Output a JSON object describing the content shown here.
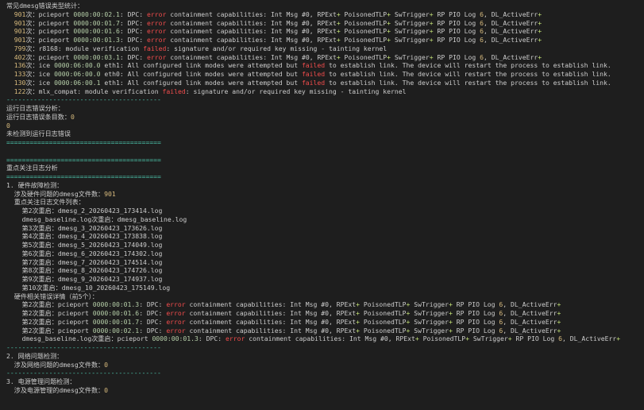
{
  "lines": [
    [
      {
        "t": "常见dmesg错误类型统计："
      }
    ],
    [
      {
        "t": "  "
      },
      {
        "t": "901",
        "c": "num"
      },
      {
        "t": "次：pcieport "
      },
      {
        "t": "0000:00:02.1",
        "c": "hex"
      },
      {
        "t": ": DPC: "
      },
      {
        "t": "error",
        "c": "err"
      },
      {
        "t": " containment capabilities: Int Msg #0, RPExt"
      },
      {
        "t": "+",
        "c": "plus"
      },
      {
        "t": " PoisonedTLP"
      },
      {
        "t": "+",
        "c": "plus"
      },
      {
        "t": " SwTrigger"
      },
      {
        "t": "+",
        "c": "plus"
      },
      {
        "t": " RP PIO Log "
      },
      {
        "t": "6",
        "c": "num"
      },
      {
        "t": ", DL_ActiveErr"
      },
      {
        "t": "+",
        "c": "plus"
      }
    ],
    [
      {
        "t": "  "
      },
      {
        "t": "901",
        "c": "num"
      },
      {
        "t": "次：pcieport "
      },
      {
        "t": "0000:00:01.7",
        "c": "hex"
      },
      {
        "t": ": DPC: "
      },
      {
        "t": "error",
        "c": "err"
      },
      {
        "t": " containment capabilities: Int Msg #0, RPExt"
      },
      {
        "t": "+",
        "c": "plus"
      },
      {
        "t": " PoisonedTLP"
      },
      {
        "t": "+",
        "c": "plus"
      },
      {
        "t": " SwTrigger"
      },
      {
        "t": "+",
        "c": "plus"
      },
      {
        "t": " RP PIO Log "
      },
      {
        "t": "6",
        "c": "num"
      },
      {
        "t": ", DL_ActiveErr"
      },
      {
        "t": "+",
        "c": "plus"
      }
    ],
    [
      {
        "t": "  "
      },
      {
        "t": "901",
        "c": "num"
      },
      {
        "t": "次：pcieport "
      },
      {
        "t": "0000:00:01.6",
        "c": "hex"
      },
      {
        "t": ": DPC: "
      },
      {
        "t": "error",
        "c": "err"
      },
      {
        "t": " containment capabilities: Int Msg #0, RPExt"
      },
      {
        "t": "+",
        "c": "plus"
      },
      {
        "t": " PoisonedTLP"
      },
      {
        "t": "+",
        "c": "plus"
      },
      {
        "t": " SwTrigger"
      },
      {
        "t": "+",
        "c": "plus"
      },
      {
        "t": " RP PIO Log "
      },
      {
        "t": "6",
        "c": "num"
      },
      {
        "t": ", DL_ActiveErr"
      },
      {
        "t": "+",
        "c": "plus"
      }
    ],
    [
      {
        "t": "  "
      },
      {
        "t": "901",
        "c": "num"
      },
      {
        "t": "次：pcieport "
      },
      {
        "t": "0000:00:01.3",
        "c": "hex"
      },
      {
        "t": ": DPC: "
      },
      {
        "t": "error",
        "c": "err"
      },
      {
        "t": " containment capabilities: Int Msg #0, RPExt"
      },
      {
        "t": "+",
        "c": "plus"
      },
      {
        "t": " PoisonedTLP"
      },
      {
        "t": "+",
        "c": "plus"
      },
      {
        "t": " SwTrigger"
      },
      {
        "t": "+",
        "c": "plus"
      },
      {
        "t": " RP PIO Log "
      },
      {
        "t": "6",
        "c": "num"
      },
      {
        "t": ", DL_ActiveErr"
      },
      {
        "t": "+",
        "c": "plus"
      }
    ],
    [
      {
        "t": "  "
      },
      {
        "t": "799",
        "c": "num"
      },
      {
        "t": "次：r8168: module verification "
      },
      {
        "t": "failed",
        "c": "err"
      },
      {
        "t": ": signature and/or required key missing - tainting kernel"
      }
    ],
    [
      {
        "t": "  "
      },
      {
        "t": "402",
        "c": "num"
      },
      {
        "t": "次：pcieport "
      },
      {
        "t": "0000:00:03.1",
        "c": "hex"
      },
      {
        "t": ": DPC: "
      },
      {
        "t": "error",
        "c": "err"
      },
      {
        "t": " containment capabilities: Int Msg #0, RPExt"
      },
      {
        "t": "+",
        "c": "plus"
      },
      {
        "t": " PoisonedTLP"
      },
      {
        "t": "+",
        "c": "plus"
      },
      {
        "t": " SwTrigger"
      },
      {
        "t": "+",
        "c": "plus"
      },
      {
        "t": " RP PIO Log "
      },
      {
        "t": "6",
        "c": "num"
      },
      {
        "t": ", DL_ActiveErr"
      },
      {
        "t": "+",
        "c": "plus"
      }
    ],
    [
      {
        "t": "  "
      },
      {
        "t": "136",
        "c": "num"
      },
      {
        "t": "次：ice "
      },
      {
        "t": "0000:06:00.0",
        "c": "hex"
      },
      {
        "t": " eth1: All configured link modes were attempted but "
      },
      {
        "t": "failed",
        "c": "err"
      },
      {
        "t": " to establish link. The device will restart the process to establish link."
      }
    ],
    [
      {
        "t": "  "
      },
      {
        "t": "133",
        "c": "num"
      },
      {
        "t": "次：ice "
      },
      {
        "t": "0000:06:00.0",
        "c": "hex"
      },
      {
        "t": " eth0: All configured link modes were attempted but "
      },
      {
        "t": "failed",
        "c": "err"
      },
      {
        "t": " to establish link. The device will restart the process to establish link."
      }
    ],
    [
      {
        "t": "  "
      },
      {
        "t": "130",
        "c": "num"
      },
      {
        "t": "次：ice "
      },
      {
        "t": "0000:06:00.1",
        "c": "hex"
      },
      {
        "t": " eth1: All configured link modes were attempted but "
      },
      {
        "t": "failed",
        "c": "err"
      },
      {
        "t": " to establish link. The device will restart the process to establish link."
      }
    ],
    [
      {
        "t": "  "
      },
      {
        "t": "122",
        "c": "num"
      },
      {
        "t": "次：mlx_compat: module verification "
      },
      {
        "t": "failed",
        "c": "err"
      },
      {
        "t": ": signature and/or required key missing - tainting kernel"
      }
    ],
    [
      {
        "t": "----------------------------------------",
        "c": "sep"
      }
    ],
    [
      {
        "t": "运行日志错误分析："
      }
    ],
    [
      {
        "t": "运行日志错误条目数："
      },
      {
        "t": "0",
        "c": "count"
      }
    ],
    [
      {
        "t": "0",
        "c": "count"
      }
    ],
    [
      {
        "t": "未检测到运行日志错误"
      }
    ],
    [
      {
        "t": "========================================",
        "c": "sep"
      }
    ],
    [
      {
        "t": ""
      }
    ],
    [
      {
        "t": "========================================",
        "c": "sep"
      }
    ],
    [
      {
        "t": "重点关注日志分析"
      }
    ],
    [
      {
        "t": "========================================",
        "c": "sep"
      }
    ],
    [
      {
        "t": "1. 硬件故障检测："
      }
    ],
    [
      {
        "t": "  涉及硬件问题的dmesg文件数："
      },
      {
        "t": "901",
        "c": "count"
      }
    ],
    [
      {
        "t": "  重点关注日志文件列表："
      }
    ],
    [
      {
        "t": "    第2次重启：dmesg_2_20260423_173414.log"
      }
    ],
    [
      {
        "t": "    dmesg_baseline.log次重启：dmesg_baseline.log"
      }
    ],
    [
      {
        "t": "    第3次重启：dmesg_3_20260423_173626.log"
      }
    ],
    [
      {
        "t": "    第4次重启：dmesg_4_20260423_173838.log"
      }
    ],
    [
      {
        "t": "    第5次重启：dmesg_5_20260423_174049.log"
      }
    ],
    [
      {
        "t": "    第6次重启：dmesg_6_20260423_174302.log"
      }
    ],
    [
      {
        "t": "    第7次重启：dmesg_7_20260423_174514.log"
      }
    ],
    [
      {
        "t": "    第8次重启：dmesg_8_20260423_174726.log"
      }
    ],
    [
      {
        "t": "    第9次重启：dmesg_9_20260423_174937.log"
      }
    ],
    [
      {
        "t": "    第10次重启：dmesg_10_20260423_175149.log"
      }
    ],
    [
      {
        "t": "  硬件相关错误详情（前5个）："
      }
    ],
    [
      {
        "t": "    第2次重启：pcieport "
      },
      {
        "t": "0000:00:01.3",
        "c": "hex"
      },
      {
        "t": ": DPC: "
      },
      {
        "t": "error",
        "c": "err"
      },
      {
        "t": " containment capabilities: Int Msg #0, RPExt"
      },
      {
        "t": "+",
        "c": "plus"
      },
      {
        "t": " PoisonedTLP"
      },
      {
        "t": "+",
        "c": "plus"
      },
      {
        "t": " SwTrigger"
      },
      {
        "t": "+",
        "c": "plus"
      },
      {
        "t": " RP PIO Log "
      },
      {
        "t": "6",
        "c": "num"
      },
      {
        "t": ", DL_ActiveErr"
      },
      {
        "t": "+",
        "c": "plus"
      }
    ],
    [
      {
        "t": "    第2次重启：pcieport "
      },
      {
        "t": "0000:00:01.6",
        "c": "hex"
      },
      {
        "t": ": DPC: "
      },
      {
        "t": "error",
        "c": "err"
      },
      {
        "t": " containment capabilities: Int Msg #0, RPExt"
      },
      {
        "t": "+",
        "c": "plus"
      },
      {
        "t": " PoisonedTLP"
      },
      {
        "t": "+",
        "c": "plus"
      },
      {
        "t": " SwTrigger"
      },
      {
        "t": "+",
        "c": "plus"
      },
      {
        "t": " RP PIO Log "
      },
      {
        "t": "6",
        "c": "num"
      },
      {
        "t": ", DL_ActiveErr"
      },
      {
        "t": "+",
        "c": "plus"
      }
    ],
    [
      {
        "t": "    第2次重启：pcieport "
      },
      {
        "t": "0000:00:01.7",
        "c": "hex"
      },
      {
        "t": ": DPC: "
      },
      {
        "t": "error",
        "c": "err"
      },
      {
        "t": " containment capabilities: Int Msg #0, RPExt"
      },
      {
        "t": "+",
        "c": "plus"
      },
      {
        "t": " PoisonedTLP"
      },
      {
        "t": "+",
        "c": "plus"
      },
      {
        "t": " SwTrigger"
      },
      {
        "t": "+",
        "c": "plus"
      },
      {
        "t": " RP PIO Log "
      },
      {
        "t": "6",
        "c": "num"
      },
      {
        "t": ", DL_ActiveErr"
      },
      {
        "t": "+",
        "c": "plus"
      }
    ],
    [
      {
        "t": "    第2次重启：pcieport "
      },
      {
        "t": "0000:00:02.1",
        "c": "hex"
      },
      {
        "t": ": DPC: "
      },
      {
        "t": "error",
        "c": "err"
      },
      {
        "t": " containment capabilities: Int Msg #0, RPExt"
      },
      {
        "t": "+",
        "c": "plus"
      },
      {
        "t": " PoisonedTLP"
      },
      {
        "t": "+",
        "c": "plus"
      },
      {
        "t": " SwTrigger"
      },
      {
        "t": "+",
        "c": "plus"
      },
      {
        "t": " RP PIO Log "
      },
      {
        "t": "6",
        "c": "num"
      },
      {
        "t": ", DL_ActiveErr"
      },
      {
        "t": "+",
        "c": "plus"
      }
    ],
    [
      {
        "t": "    dmesg_baseline.log次重启：pcieport "
      },
      {
        "t": "0000:00:01.3",
        "c": "hex"
      },
      {
        "t": ": DPC: "
      },
      {
        "t": "error",
        "c": "err"
      },
      {
        "t": " containment capabilities: Int Msg #0, RPExt"
      },
      {
        "t": "+",
        "c": "plus"
      },
      {
        "t": " PoisonedTLP"
      },
      {
        "t": "+",
        "c": "plus"
      },
      {
        "t": " SwTrigger"
      },
      {
        "t": "+",
        "c": "plus"
      },
      {
        "t": " RP PIO Log "
      },
      {
        "t": "6",
        "c": "num"
      },
      {
        "t": ", DL_ActiveErr"
      },
      {
        "t": "+",
        "c": "plus"
      }
    ],
    [
      {
        "t": "----------------------------------------",
        "c": "sep"
      }
    ],
    [
      {
        "t": "2. 网络问题检测："
      }
    ],
    [
      {
        "t": "  涉及网络问题的dmesg文件数："
      },
      {
        "t": "0",
        "c": "count"
      }
    ],
    [
      {
        "t": "----------------------------------------",
        "c": "sep"
      }
    ],
    [
      {
        "t": "3. 电源管理问题检测："
      }
    ],
    [
      {
        "t": "  涉及电源管理的dmesg文件数："
      },
      {
        "t": "0",
        "c": "count"
      }
    ]
  ],
  "colors": {
    "background": "#1e1e1e",
    "text": "#cccccc",
    "number": "#d7ba7d",
    "pci_address": "#b5cea8",
    "error_word": "#f14c4c",
    "plus_flag": "#c5e478",
    "separator": "#4ec9b0"
  }
}
